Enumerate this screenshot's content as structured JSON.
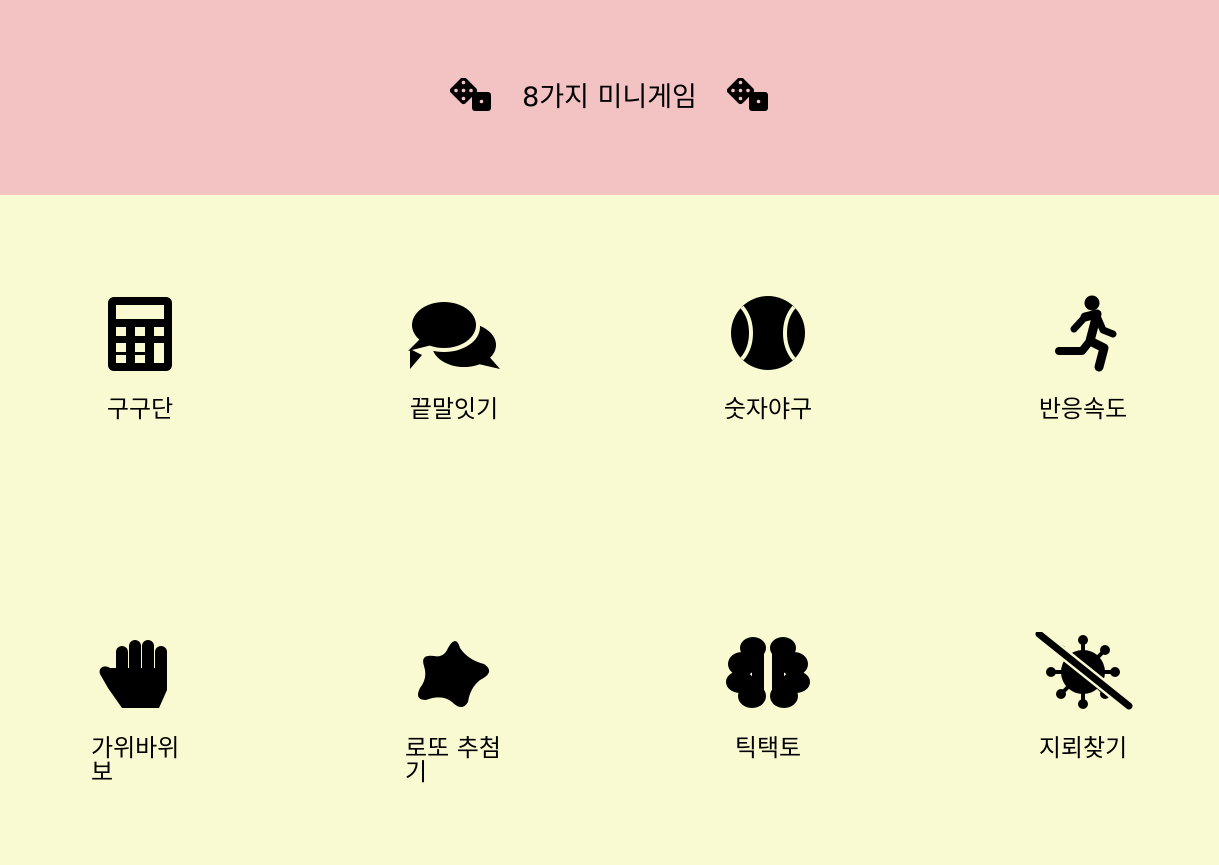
{
  "header": {
    "title": "8가지 미니게임",
    "left_icon": "dice-icon",
    "right_icon": "dice-icon",
    "background": "#f3c2c3"
  },
  "main": {
    "background": "#f9f9d2",
    "games": [
      {
        "label": "구구단",
        "icon": "calculator-icon"
      },
      {
        "label": "끝말잇기",
        "icon": "comments-icon"
      },
      {
        "label": "숫자야구",
        "icon": "baseball-icon"
      },
      {
        "label": "반응속도",
        "icon": "running-person-icon"
      },
      {
        "label": "가위바위보",
        "icon": "hand-icon"
      },
      {
        "label": "로또 추첨기",
        "icon": "star-icon"
      },
      {
        "label": "틱택토",
        "icon": "brain-icon"
      },
      {
        "label": "지뢰찾기",
        "icon": "virus-slash-icon"
      }
    ]
  }
}
